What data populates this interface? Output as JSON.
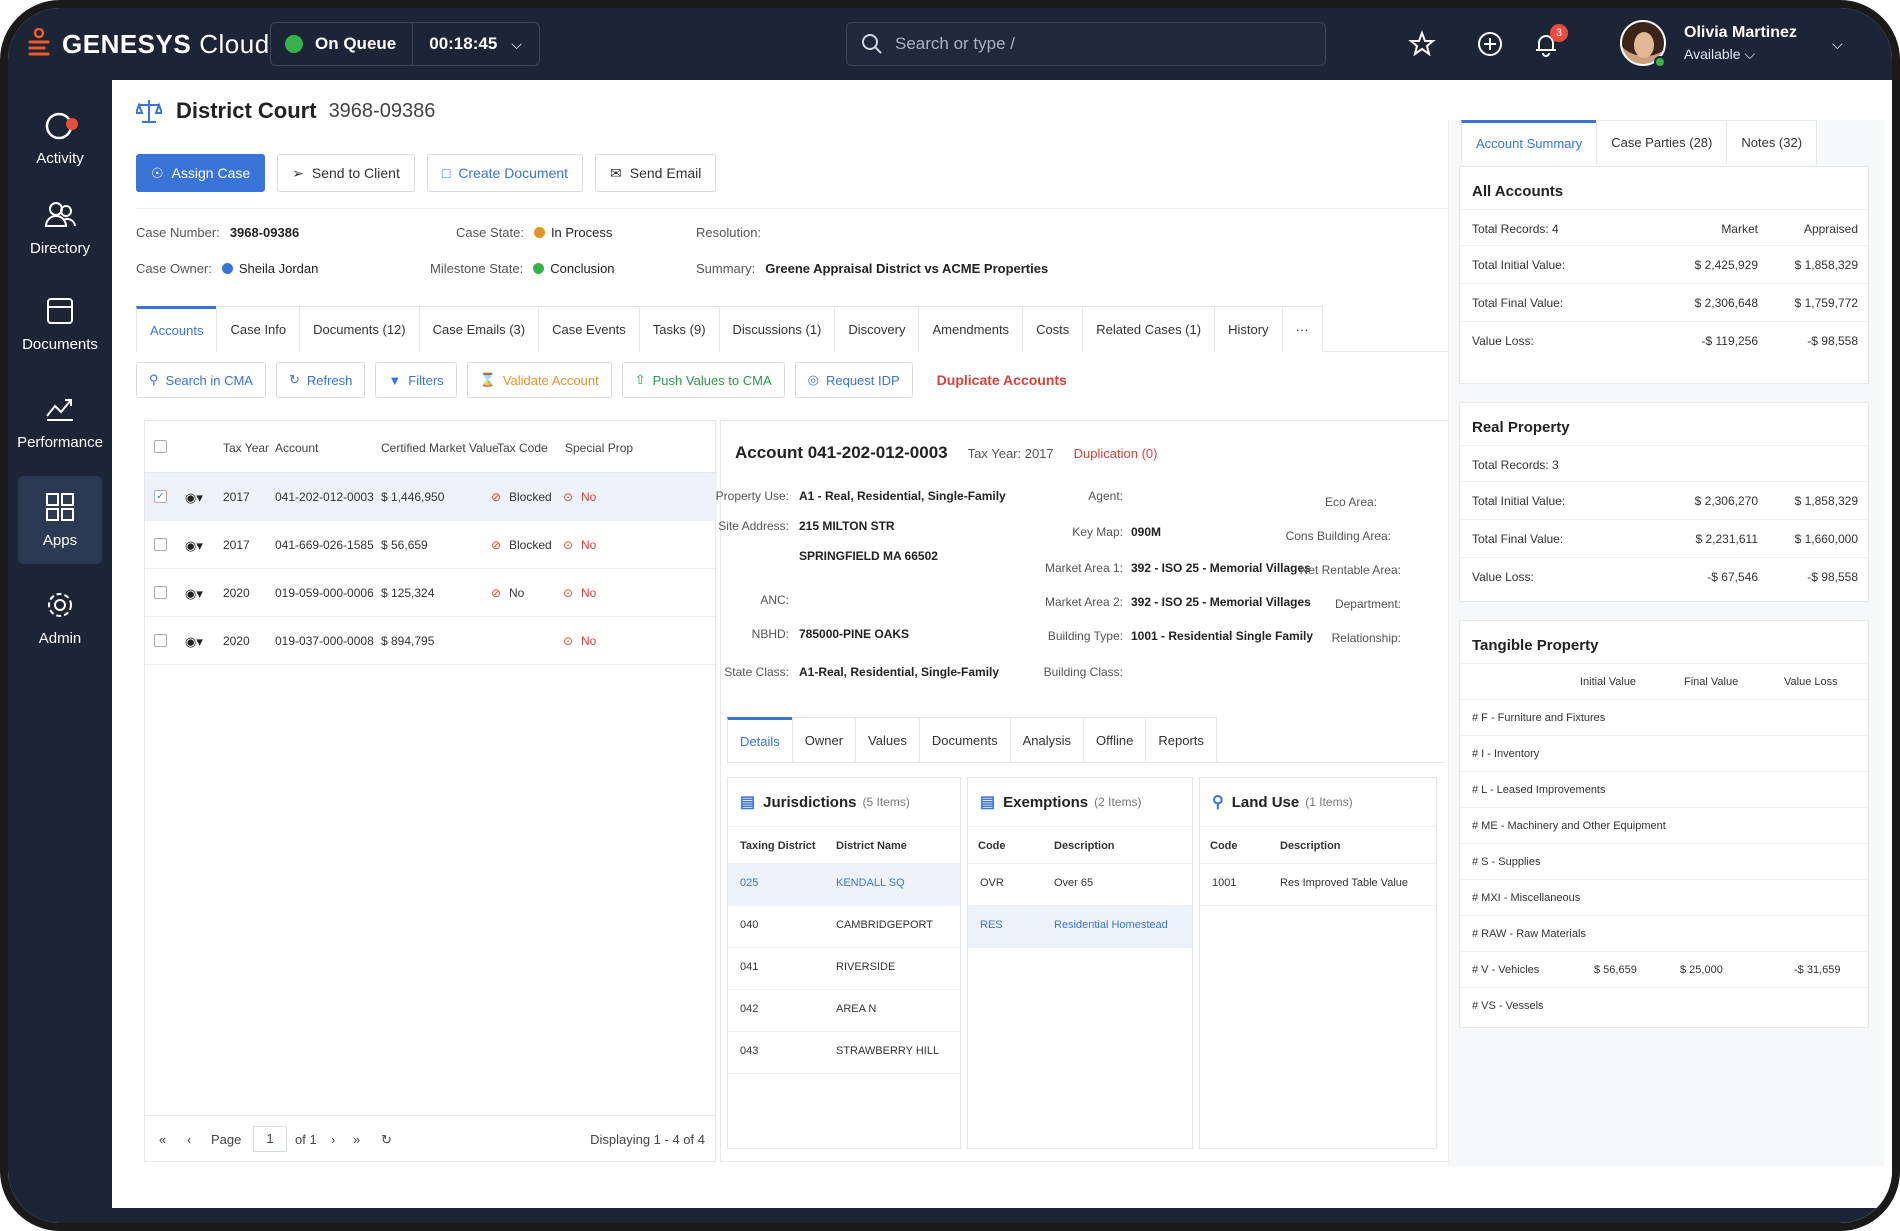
{
  "app": {
    "brand_bold": "GENESYS",
    "brand_light": "Cloud"
  },
  "queue": {
    "label": "On Queue",
    "timer": "00:18:45",
    "status_color": "#36b24a"
  },
  "search": {
    "placeholder": "Search or type /"
  },
  "notifications": {
    "count": "3"
  },
  "user": {
    "name": "Olivia Martinez",
    "status": "Available"
  },
  "sidebar": {
    "items": [
      {
        "label": "Activity",
        "icon": "activity-icon"
      },
      {
        "label": "Directory",
        "icon": "directory-icon"
      },
      {
        "label": "Documents",
        "icon": "documents-icon"
      },
      {
        "label": "Performance",
        "icon": "performance-icon"
      },
      {
        "label": "Apps",
        "icon": "apps-icon",
        "active": true
      },
      {
        "label": "Admin",
        "icon": "gear-icon"
      }
    ]
  },
  "case": {
    "title": "District Court",
    "number": "3968-09386",
    "actions": {
      "assign": "Assign Case",
      "send_client": "Send to Client",
      "create_doc": "Create Document",
      "send_email": "Send Email"
    },
    "meta": {
      "case_number_label": "Case Number:",
      "case_number": "3968-09386",
      "case_state_label": "Case State:",
      "case_state": "In Process",
      "resolution_label": "Resolution:",
      "case_owner_label": "Case Owner:",
      "case_owner": "Sheila Jordan",
      "milestone_label": "Milestone State:",
      "milestone": "Conclusion",
      "summary_label": "Summary:",
      "summary": "Greene Appraisal District vs ACME Properties"
    },
    "tabs": [
      "Accounts",
      "Case Info",
      "Documents (12)",
      "Case Emails (3)",
      "Case Events",
      "Tasks (9)",
      "Discussions (1)",
      "Discovery",
      "Amendments",
      "Costs",
      "Related Cases (1)",
      "History",
      "···"
    ]
  },
  "toolbar": {
    "search_cma": "Search in CMA",
    "refresh": "Refresh",
    "filters": "Filters",
    "validate": "Validate Account",
    "push": "Push Values to CMA",
    "request_idp": "Request IDP",
    "duplicate": "Duplicate Accounts"
  },
  "accounts": {
    "headers": {
      "tax_year": "Tax Year",
      "account": "Account",
      "cmv": "Certified Market Value",
      "tax_code": "Tax Code",
      "special": "Special Prop"
    },
    "rows": [
      {
        "year": "2017",
        "account": "041-202-012-0003",
        "value": "$ 1,446,950",
        "tax": "Blocked",
        "special": "No",
        "checked": "✓"
      },
      {
        "year": "2017",
        "account": "041-669-026-1585",
        "value": "$ 56,659",
        "tax": "Blocked",
        "special": "No",
        "checked": ""
      },
      {
        "year": "2020",
        "account": "019-059-000-0006",
        "value": "$ 125,324",
        "tax": "No",
        "special": "No",
        "checked": ""
      },
      {
        "year": "2020",
        "account": "019-037-000-0008",
        "value": "$ 894,795",
        "tax": "",
        "special": "No",
        "checked": ""
      }
    ],
    "pager": {
      "page_label": "Page",
      "page": "1",
      "of": "of 1",
      "displaying": "Displaying 1 - 4 of 4"
    }
  },
  "detail": {
    "account": "Account 041-202-012-0003",
    "tax_year": "Tax Year: 2017",
    "duplication": "Duplication (0)",
    "fields": {
      "property_use_label": "Property Use:",
      "property_use": "A1 - Real, Residential, Single-Family",
      "site_address_label": "Site Address:",
      "site_address_1": "215 MILTON STR",
      "site_address_2": "SPRINGFIELD MA 66502",
      "anc_label": "ANC:",
      "nbhd_label": "NBHD:",
      "nbhd": "785000-PINE OAKS",
      "state_class_label": "State Class:",
      "state_class": "A1-Real, Residential, Single-Family",
      "agent_label": "Agent:",
      "key_map_label": "Key Map:",
      "key_map": "090M",
      "market1_label": "Market Area 1:",
      "market1": "392 - ISO 25 - Memorial Villages",
      "market2_label": "Market Area 2:",
      "market2": "392 - ISO 25 - Memorial Villages",
      "building_type_label": "Building Type:",
      "building_type": "1001 - Residential Single Family",
      "building_class_label": "Building Class:",
      "eco_label": "Eco Area:",
      "cons_label": "Cons Building Area:",
      "net_label": "Net Rentable Area:",
      "dept_label": "Department:",
      "rel_label": "Relationship:"
    },
    "tabs": [
      "Details",
      "Owner",
      "Values",
      "Documents",
      "Analysis",
      "Offline",
      "Reports"
    ],
    "jurisdictions": {
      "title": "Jurisdictions",
      "count": "(5 Items)",
      "h1": "Taxing District",
      "h2": "District Name",
      "rows": [
        {
          "code": "025",
          "name": "KENDALL SQ"
        },
        {
          "code": "040",
          "name": "CAMBRIDGEPORT"
        },
        {
          "code": "041",
          "name": "RIVERSIDE"
        },
        {
          "code": "042",
          "name": "AREA N"
        },
        {
          "code": "043",
          "name": "STRAWBERRY HILL"
        }
      ]
    },
    "exemptions": {
      "title": "Exemptions",
      "count": "(2 Items)",
      "h1": "Code",
      "h2": "Description",
      "rows": [
        {
          "code": "OVR",
          "name": "Over 65"
        },
        {
          "code": "RES",
          "name": "Residential Homestead"
        }
      ]
    },
    "landuse": {
      "title": "Land Use",
      "count": "(1 Items)",
      "h1": "Code",
      "h2": "Description",
      "rows": [
        {
          "code": "1001",
          "name": "Res Improved Table Value"
        }
      ]
    }
  },
  "right": {
    "tabs": [
      "Account Summary",
      "Case Parties (28)",
      "Notes (32)"
    ],
    "all_accounts": {
      "title": "All Accounts",
      "records": "Total Records: 4",
      "h_market": "Market",
      "h_appraised": "Appraised",
      "rows": [
        {
          "label": "Total Initial Value:",
          "market": "$ 2,425,929",
          "appraised": "$ 1,858,329"
        },
        {
          "label": "Total Final Value:",
          "market": "$ 2,306,648",
          "appraised": "$ 1,759,772"
        },
        {
          "label": "Value Loss:",
          "market": "-$ 119,256",
          "appraised": "-$ 98,558"
        }
      ]
    },
    "real_property": {
      "title": "Real Property",
      "records": "Total Records: 3",
      "rows": [
        {
          "label": "Total Initial Value:",
          "market": "$ 2,306,270",
          "appraised": "$ 1,858,329"
        },
        {
          "label": "Total Final Value:",
          "market": "$ 2,231,611",
          "appraised": "$ 1,660,000"
        },
        {
          "label": "Value Loss:",
          "market": "-$ 67,546",
          "appraised": "-$ 98,558"
        }
      ]
    },
    "tangible": {
      "title": "Tangible Property",
      "h_initial": "Initial Value",
      "h_final": "Final Value",
      "h_loss": "Value Loss",
      "rows": [
        {
          "label": "#  F  - Furniture and Fixtures",
          "initial": "",
          "final": "",
          "loss": ""
        },
        {
          "label": "#  I  - Inventory",
          "initial": "",
          "final": "",
          "loss": ""
        },
        {
          "label": "#  L  - Leased Improvements",
          "initial": "",
          "final": "",
          "loss": ""
        },
        {
          "label": "#  ME - Machinery and Other Equipment",
          "initial": "",
          "final": "",
          "loss": ""
        },
        {
          "label": "#  S  - Supplies",
          "initial": "",
          "final": "",
          "loss": ""
        },
        {
          "label": "#  MXI - Miscellaneous",
          "initial": "",
          "final": "",
          "loss": ""
        },
        {
          "label": "#  RAW - Raw Materials",
          "initial": "",
          "final": "",
          "loss": ""
        },
        {
          "label": "#  V - Vehicles",
          "initial": "$ 56,659",
          "final": "$ 25,000",
          "loss": "-$ 31,659"
        },
        {
          "label": "#  VS - Vessels",
          "initial": "",
          "final": "",
          "loss": ""
        }
      ]
    }
  }
}
